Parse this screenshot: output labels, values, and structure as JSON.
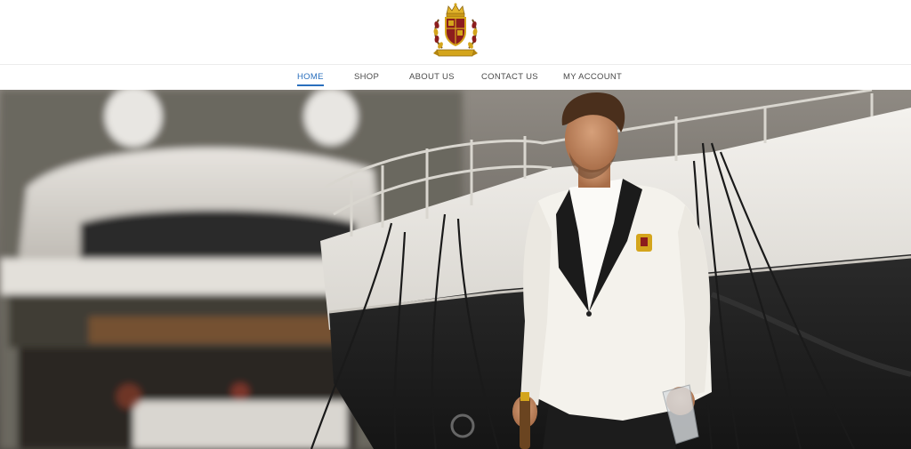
{
  "brand": {
    "logo_icon": "royal-crest-logo",
    "colors": {
      "gold": "#d4a51c",
      "crimson": "#8c1d1d",
      "accent": "#2a6fbd"
    }
  },
  "nav": {
    "items": [
      {
        "label": "HOME",
        "active": true
      },
      {
        "label": "SHOP",
        "active": false
      },
      {
        "label": "ABOUT US",
        "active": false
      },
      {
        "label": "CONTACT US",
        "active": false
      },
      {
        "label": "MY ACCOUNT",
        "active": false
      }
    ]
  },
  "hero": {
    "scene": "hero-photo-man-white-tuxedo-yacht-marina"
  }
}
